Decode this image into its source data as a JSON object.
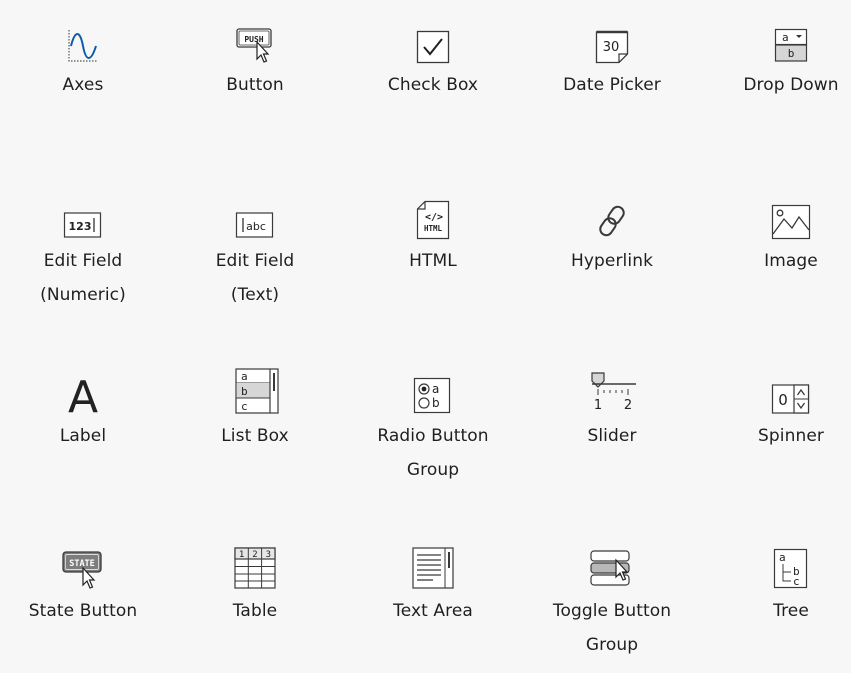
{
  "components": [
    {
      "label": "Axes",
      "icon": "axes-icon"
    },
    {
      "label": "Button",
      "icon": "push-button-icon"
    },
    {
      "label": "Check Box",
      "icon": "checkbox-icon"
    },
    {
      "label": "Date Picker",
      "icon": "calendar-icon"
    },
    {
      "label": "Drop Down",
      "icon": "dropdown-icon"
    },
    {
      "label": "Edit Field\n(Numeric)",
      "icon": "numeric-field-icon"
    },
    {
      "label": "Edit Field\n(Text)",
      "icon": "text-field-icon"
    },
    {
      "label": "HTML",
      "icon": "html-file-icon"
    },
    {
      "label": "Hyperlink",
      "icon": "link-icon"
    },
    {
      "label": "Image",
      "icon": "image-icon"
    },
    {
      "label": "Label",
      "icon": "label-icon"
    },
    {
      "label": "List Box",
      "icon": "listbox-icon"
    },
    {
      "label": "Radio Button\nGroup",
      "icon": "radio-group-icon"
    },
    {
      "label": "Slider",
      "icon": "slider-icon"
    },
    {
      "label": "Spinner",
      "icon": "spinner-icon"
    },
    {
      "label": "State Button",
      "icon": "state-button-icon"
    },
    {
      "label": "Table",
      "icon": "table-icon"
    },
    {
      "label": "Text Area",
      "icon": "textarea-icon"
    },
    {
      "label": "Toggle Button\nGroup",
      "icon": "toggle-group-icon"
    },
    {
      "label": "Tree",
      "icon": "tree-icon"
    }
  ],
  "icon_text": {
    "push": "PUSH",
    "date": "30",
    "dropdown_a": "a",
    "dropdown_b": "b",
    "numeric": "123",
    "text": "abc",
    "html_tag": "</>",
    "html_word": "HTML",
    "label_letter": "A",
    "list_a": "a",
    "list_b": "b",
    "list_c": "c",
    "radio_a": "a",
    "radio_b": "b",
    "slider_1": "1",
    "slider_2": "2",
    "spinner_val": "0",
    "state": "STATE",
    "table_1": "1",
    "table_2": "2",
    "table_3": "3",
    "tree_a": "a",
    "tree_b": "b",
    "tree_c": "c"
  },
  "colors": {
    "background": "#f7f7f7",
    "icon_stroke": "#3a3a3a",
    "accent_blue": "#0b5cab",
    "select_fill": "#d6d6d6"
  }
}
